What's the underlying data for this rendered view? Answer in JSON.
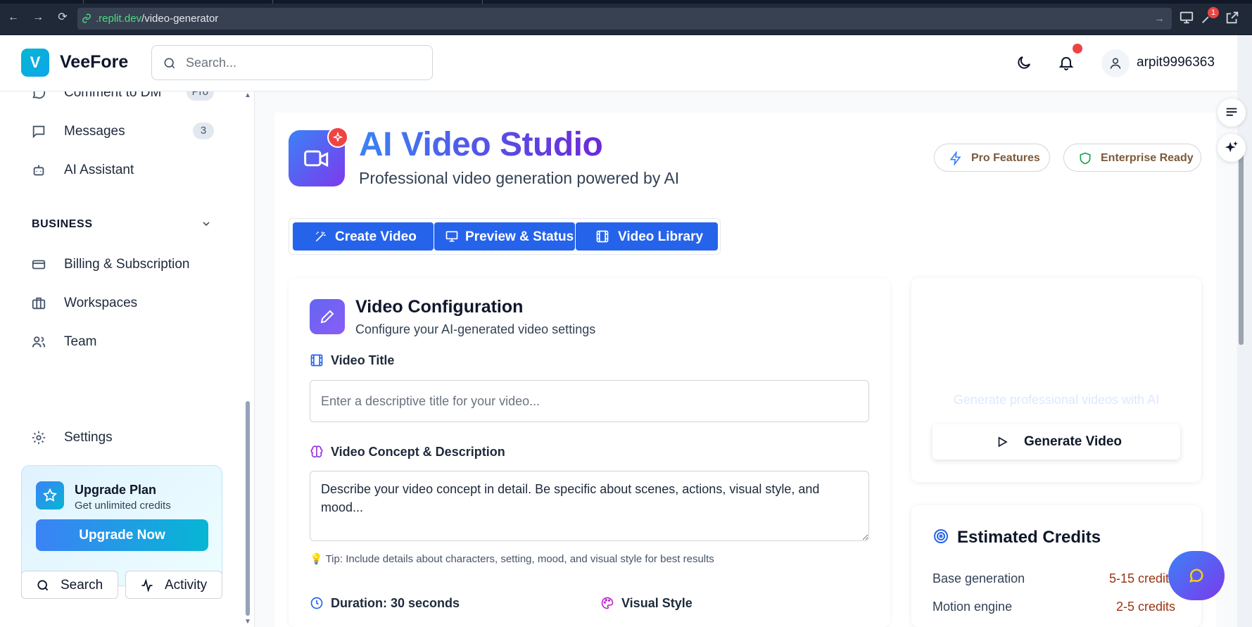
{
  "browser": {
    "url_domain": ".replit.dev",
    "url_path": "/video-generator",
    "notification_count": "1"
  },
  "header": {
    "logo_letter": "V",
    "app_name": "VeeFore",
    "search_placeholder": "Search...",
    "username": "arpit9996363"
  },
  "sidebar": {
    "items": [
      {
        "label": "Comment to DM",
        "badge": "Pro"
      },
      {
        "label": "Messages",
        "badge": "3"
      },
      {
        "label": "AI Assistant"
      }
    ],
    "section_title": "BUSINESS",
    "business_items": [
      {
        "label": "Billing & Subscription"
      },
      {
        "label": "Workspaces"
      },
      {
        "label": "Team"
      }
    ],
    "settings_label": "Settings",
    "upgrade": {
      "title": "Upgrade Plan",
      "subtitle": "Get unlimited credits",
      "button": "Upgrade Now"
    },
    "search_button": "Search",
    "activity_button": "Activity"
  },
  "hero": {
    "title": "AI Video Studio",
    "subtitle": "Professional video generation powered by AI",
    "pill_pro": "Pro Features",
    "pill_enterprise": "Enterprise Ready"
  },
  "tabs": [
    {
      "label": "Create Video"
    },
    {
      "label": "Preview & Status"
    },
    {
      "label": "Video Library"
    }
  ],
  "config": {
    "title": "Video Configuration",
    "subtitle": "Configure your AI-generated video settings",
    "title_label": "Video Title",
    "title_placeholder": "Enter a descriptive title for your video...",
    "concept_label": "Video Concept & Description",
    "concept_placeholder": "Describe your video concept in detail. Be specific about scenes, actions, visual style, and mood...",
    "tip": "💡 Tip: Include details about characters, setting, mood, and visual style for best results",
    "duration_label": "Duration: 30 seconds",
    "style_label": "Visual Style"
  },
  "generate": {
    "faint_text": "Generate professional videos with AI",
    "button": "Generate Video"
  },
  "credits": {
    "title": "Estimated Credits",
    "rows": [
      {
        "label": "Base generation",
        "value": "5-15 credits"
      },
      {
        "label": "Motion engine",
        "value": "2-5 credits"
      }
    ]
  },
  "colors": {
    "primary": "#2563eb",
    "accent_purple": "#7c3aed",
    "brand_cyan": "#06b6d4",
    "alert_red": "#ef4444"
  }
}
